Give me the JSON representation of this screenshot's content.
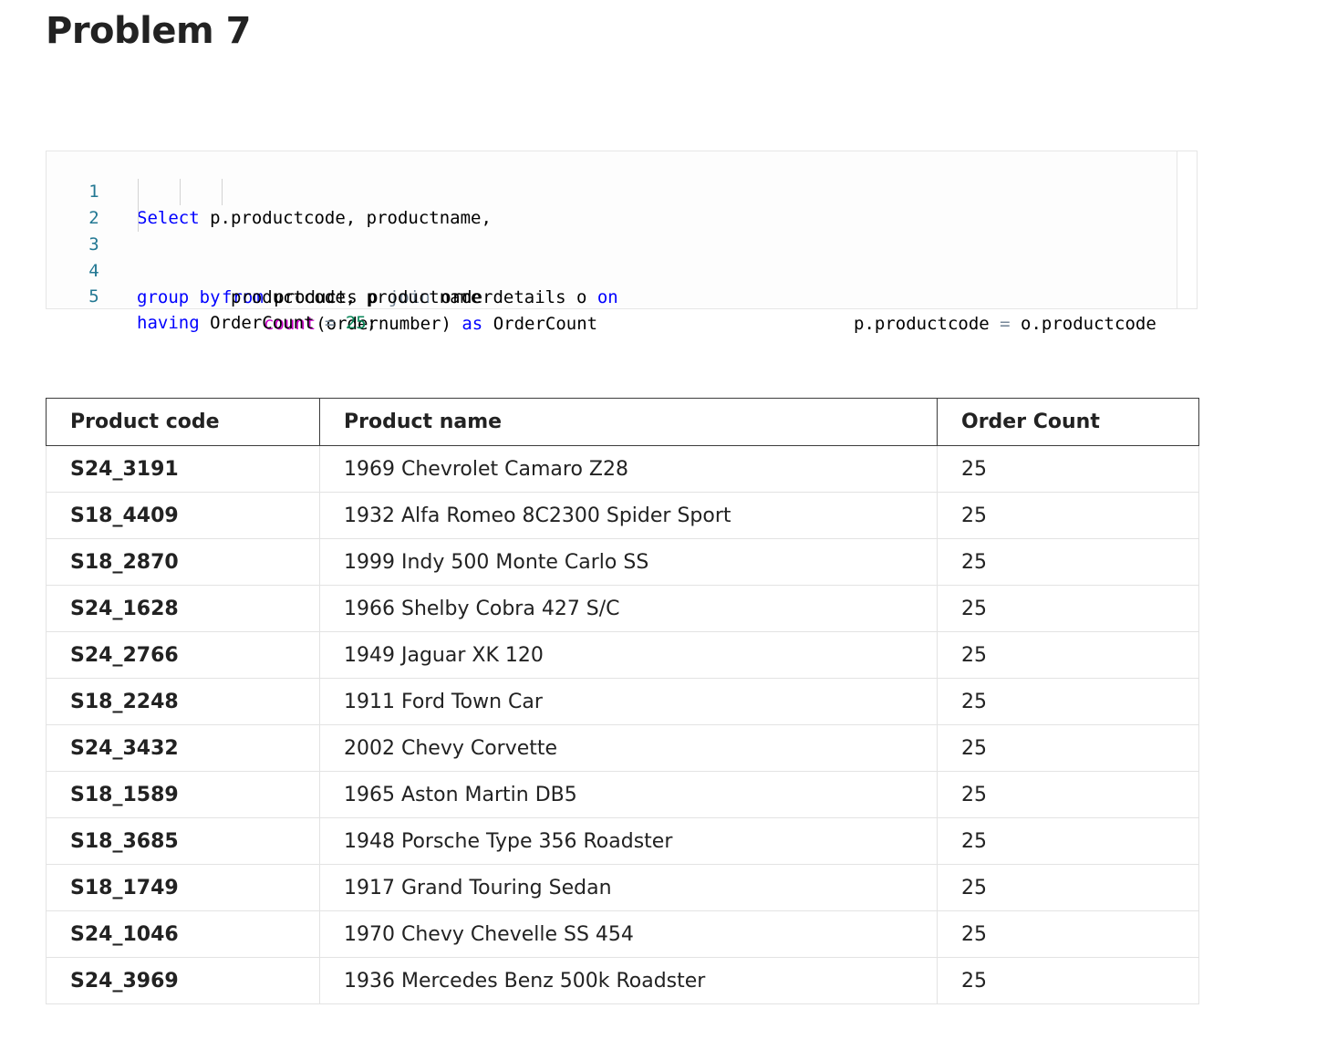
{
  "page": {
    "title": "Problem 7"
  },
  "code": {
    "lines": [
      {
        "number": "1",
        "tokens": [
          {
            "text": "Select",
            "kind": "kw"
          },
          {
            "text": " p.productcode, productname,",
            "kind": "plain"
          }
        ]
      },
      {
        "number": "2",
        "tokens": [
          {
            "text": "count",
            "kind": "fn"
          },
          {
            "text": "(ordernumber) ",
            "kind": "plain"
          },
          {
            "text": "as",
            "kind": "kw"
          },
          {
            "text": " OrderCount",
            "kind": "plain"
          }
        ]
      },
      {
        "number": "3",
        "tokens": [
          {
            "text": "from",
            "kind": "kw"
          },
          {
            "text": " products p ",
            "kind": "plain"
          },
          {
            "text": "join",
            "kind": "op"
          },
          {
            "text": " orderdetails o ",
            "kind": "plain"
          },
          {
            "text": "on",
            "kind": "kw"
          }
        ],
        "tail_tokens": [
          {
            "text": "p.productcode ",
            "kind": "plain"
          },
          {
            "text": "=",
            "kind": "op"
          },
          {
            "text": " o.productcode",
            "kind": "plain"
          }
        ]
      },
      {
        "number": "4",
        "tokens": [
          {
            "text": "group by",
            "kind": "kw"
          },
          {
            "text": " productcode, productname",
            "kind": "plain"
          }
        ]
      },
      {
        "number": "5",
        "tokens": [
          {
            "text": "having",
            "kind": "kw"
          },
          {
            "text": " OrderCount ",
            "kind": "plain"
          },
          {
            "text": "=",
            "kind": "op"
          },
          {
            "text": " ",
            "kind": "plain"
          },
          {
            "text": "25",
            "kind": "num"
          },
          {
            "text": ";",
            "kind": "plain"
          }
        ]
      }
    ]
  },
  "table": {
    "headers": {
      "code": "Product code",
      "name": "Product name",
      "count": "Order Count"
    },
    "rows": [
      {
        "code": "S24_3191",
        "name": "1969 Chevrolet Camaro Z28",
        "count": "25"
      },
      {
        "code": "S18_4409",
        "name": "1932 Alfa Romeo 8C2300 Spider Sport",
        "count": "25"
      },
      {
        "code": "S18_2870",
        "name": "1999 Indy 500 Monte Carlo SS",
        "count": "25"
      },
      {
        "code": "S24_1628",
        "name": "1966 Shelby Cobra 427 S/C",
        "count": "25"
      },
      {
        "code": "S24_2766",
        "name": "1949 Jaguar XK 120",
        "count": "25"
      },
      {
        "code": "S18_2248",
        "name": "1911 Ford Town Car",
        "count": "25"
      },
      {
        "code": "S24_3432",
        "name": "2002 Chevy Corvette",
        "count": "25"
      },
      {
        "code": "S18_1589",
        "name": "1965 Aston Martin DB5",
        "count": "25"
      },
      {
        "code": "S18_3685",
        "name": "1948 Porsche Type 356 Roadster",
        "count": "25"
      },
      {
        "code": "S18_1749",
        "name": "1917 Grand Touring Sedan",
        "count": "25"
      },
      {
        "code": "S24_1046",
        "name": "1970 Chevy Chevelle SS 454",
        "count": "25"
      },
      {
        "code": "S24_3969",
        "name": "1936 Mercedes Benz 500k Roadster",
        "count": "25"
      }
    ]
  }
}
